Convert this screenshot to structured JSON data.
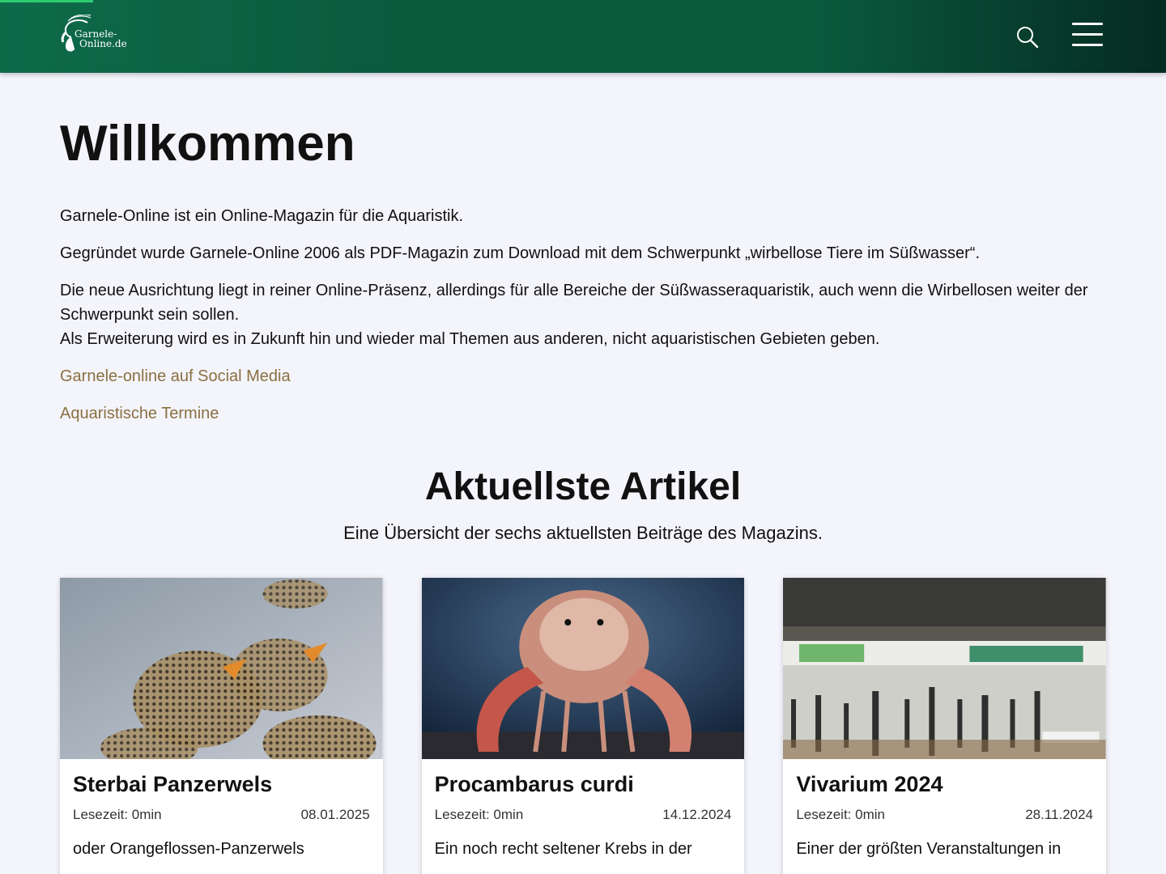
{
  "site": {
    "logo_line1": "Garnele-",
    "logo_line2": "Online.de",
    "scroll_progress_percent": 8
  },
  "header": {
    "search_icon": "search-icon",
    "menu_icon": "hamburger-menu-icon"
  },
  "intro": {
    "title": "Willkommen",
    "p1": "Garnele-Online ist ein Online-Magazin für die Aquaristik.",
    "p2": "Gegründet wurde Garnele-Online 2006 als PDF-Magazin zum Download mit dem Schwerpunkt „wirbellose Tiere im Süßwasser“.",
    "p3a": "Die neue Ausrichtung liegt in reiner Online-Präsenz, allerdings für alle Bereiche der Süßwasseraquaristik, auch wenn die Wirbellosen weiter der Schwerpunkt sein sollen.",
    "p3b": "Als Erweiterung wird es in Zukunft hin und wieder mal Themen aus anderen, nicht aquaristischen Gebieten geben.",
    "link_social": "Garnele-online auf Social Media",
    "link_events": "Aquaristische Termine"
  },
  "latest": {
    "title": "Aktuellste Artikel",
    "subtitle": "Eine Übersicht der sechs aktuellsten Beiträge des Magazins.",
    "articles": [
      {
        "title": "Sterbai Panzerwels",
        "reading_time": "Lesezeit: 0min",
        "date": "08.01.2025",
        "excerpt": "oder Orangeflossen-Panzerwels"
      },
      {
        "title": "Procambarus curdi",
        "reading_time": "Lesezeit: 0min",
        "date": "14.12.2024",
        "excerpt": "Ein noch recht seltener Krebs in der"
      },
      {
        "title": "Vivarium 2024",
        "reading_time": "Lesezeit: 0min",
        "date": "28.11.2024",
        "excerpt": "Einer der größten Veranstaltungen in"
      }
    ]
  },
  "colors": {
    "header_green": "#0a5a3e",
    "progress": "#2ecc71",
    "link": "#8a7040",
    "background": "#f4f4fb"
  }
}
